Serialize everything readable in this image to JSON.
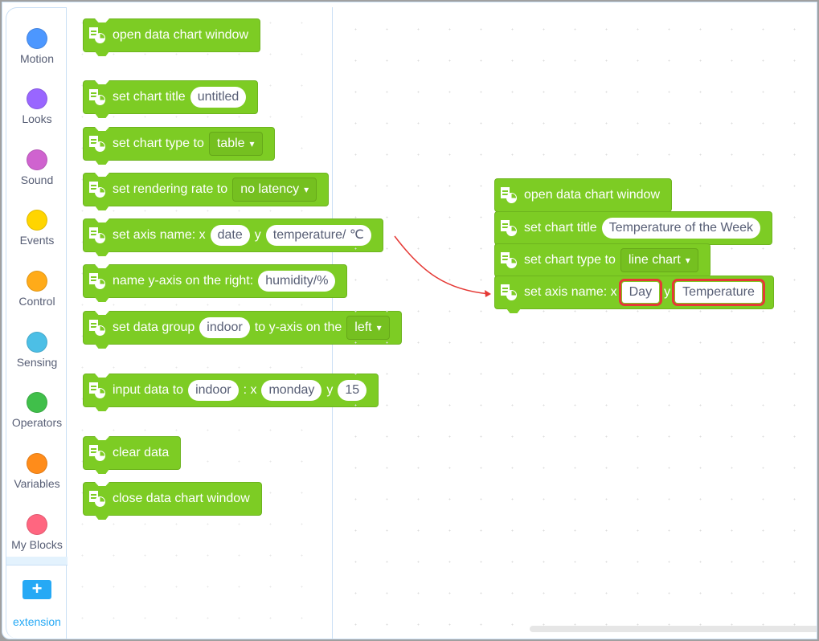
{
  "sidebar": {
    "categories": [
      {
        "label": "Motion",
        "color": "#4c97ff"
      },
      {
        "label": "Looks",
        "color": "#9966ff"
      },
      {
        "label": "Sound",
        "color": "#cf63cf"
      },
      {
        "label": "Events",
        "color": "#ffd500"
      },
      {
        "label": "Control",
        "color": "#ffab19"
      },
      {
        "label": "Sensing",
        "color": "#4cbfe6"
      },
      {
        "label": "Operators",
        "color": "#40bf4a"
      },
      {
        "label": "Variables",
        "color": "#ff8c1a"
      },
      {
        "label": "My Blocks",
        "color": "#ff6680"
      }
    ],
    "extension": {
      "icon": "plus-icon",
      "symbol": "+",
      "label": "extension"
    }
  },
  "palette": {
    "blocks": [
      {
        "parts": [
          {
            "t": "text",
            "v": "open data chart window"
          }
        ]
      },
      {
        "parts": [
          {
            "t": "text",
            "v": "set chart title"
          },
          {
            "t": "field",
            "v": "untitled"
          }
        ]
      },
      {
        "parts": [
          {
            "t": "text",
            "v": "set chart type to"
          },
          {
            "t": "dropdown",
            "v": "table"
          }
        ]
      },
      {
        "parts": [
          {
            "t": "text",
            "v": "set rendering rate to"
          },
          {
            "t": "dropdown",
            "v": "no latency"
          }
        ]
      },
      {
        "parts": [
          {
            "t": "text",
            "v": "set axis name: x"
          },
          {
            "t": "field",
            "v": "date"
          },
          {
            "t": "text",
            "v": "y"
          },
          {
            "t": "field",
            "v": "temperature/ ℃"
          }
        ]
      },
      {
        "parts": [
          {
            "t": "text",
            "v": "name y-axis on the right:"
          },
          {
            "t": "field",
            "v": "humidity/%"
          }
        ]
      },
      {
        "parts": [
          {
            "t": "text",
            "v": "set data group"
          },
          {
            "t": "field",
            "v": "indoor"
          },
          {
            "t": "text",
            "v": "to y-axis on the"
          },
          {
            "t": "dropdown",
            "v": "left"
          }
        ]
      },
      {
        "parts": [
          {
            "t": "text",
            "v": "input data to"
          },
          {
            "t": "field",
            "v": "indoor"
          },
          {
            "t": "text",
            "v": ": x"
          },
          {
            "t": "field",
            "v": "monday"
          },
          {
            "t": "text",
            "v": "y"
          },
          {
            "t": "field",
            "v": "15"
          }
        ]
      },
      {
        "parts": [
          {
            "t": "text",
            "v": "clear data"
          }
        ]
      },
      {
        "parts": [
          {
            "t": "text",
            "v": "close data chart window"
          }
        ]
      }
    ]
  },
  "workspace": {
    "blocks": [
      {
        "parts": [
          {
            "t": "text",
            "v": "open data chart window"
          }
        ]
      },
      {
        "parts": [
          {
            "t": "text",
            "v": "set chart title"
          },
          {
            "t": "field",
            "v": "Temperature of the Week"
          }
        ]
      },
      {
        "parts": [
          {
            "t": "text",
            "v": "set chart type to"
          },
          {
            "t": "dropdown",
            "v": "line chart"
          }
        ]
      },
      {
        "parts": [
          {
            "t": "text",
            "v": "set axis name: x"
          },
          {
            "t": "field",
            "v": "Day",
            "highlight": true
          },
          {
            "t": "text",
            "v": "y"
          },
          {
            "t": "field",
            "v": "Temperature",
            "highlight": true
          }
        ]
      }
    ],
    "annotation_color": "#e53935"
  },
  "block_color": "#7dcc24",
  "dropdown_arrow": "▾"
}
